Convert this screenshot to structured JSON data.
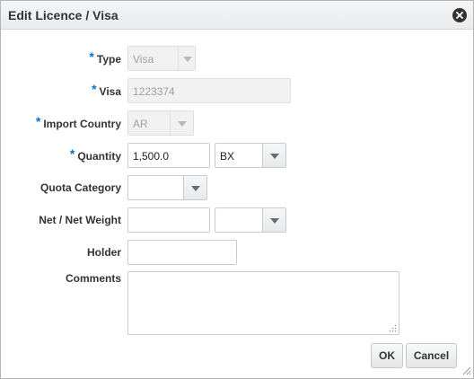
{
  "dialog": {
    "title": "Edit Licence / Visa"
  },
  "form": {
    "required_marker": "*",
    "type": {
      "label": "Type",
      "value": "Visa",
      "required": true,
      "disabled": true
    },
    "visa": {
      "label": "Visa",
      "value": "1223374",
      "required": true,
      "disabled": true
    },
    "import_country": {
      "label": "Import Country",
      "value": "AR",
      "required": true,
      "disabled": true
    },
    "quantity": {
      "label": "Quantity",
      "value": "1,500.0",
      "uom": "BX",
      "required": true
    },
    "quota_category": {
      "label": "Quota Category",
      "value": ""
    },
    "net_weight": {
      "label": "Net / Net Weight",
      "value": "",
      "uom": ""
    },
    "holder": {
      "label": "Holder",
      "value": ""
    },
    "comments": {
      "label": "Comments",
      "value": ""
    }
  },
  "buttons": {
    "ok": "OK",
    "cancel": "Cancel"
  },
  "icons": {
    "close": "close-icon",
    "dropdown": "chevron-down-icon",
    "resize": "resize-grip-icon"
  },
  "colors": {
    "required_marker": "#0572ce",
    "title_bar": "#eceeef"
  }
}
